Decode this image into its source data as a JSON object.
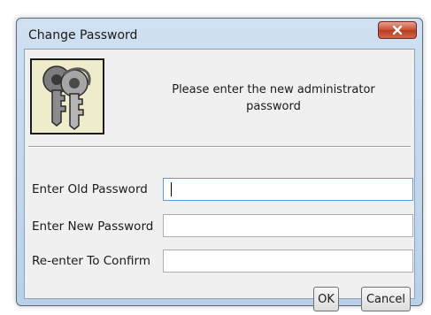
{
  "window": {
    "title": "Change Password",
    "close_glyph": "x"
  },
  "header": {
    "icon": "keys-icon",
    "prompt": "Please enter the new administrator password"
  },
  "fields": [
    {
      "label": "Enter Old Password",
      "value": "",
      "focused": true
    },
    {
      "label": "Enter New Password",
      "value": "",
      "focused": false
    },
    {
      "label": "Re-enter To Confirm",
      "value": "",
      "focused": false
    }
  ],
  "buttons": {
    "ok_label": "OK",
    "cancel_label": "Cancel"
  },
  "colors": {
    "titlebar": "#c4d8ee",
    "close_button": "#c64f34",
    "content_bg": "#f0f0f0"
  }
}
